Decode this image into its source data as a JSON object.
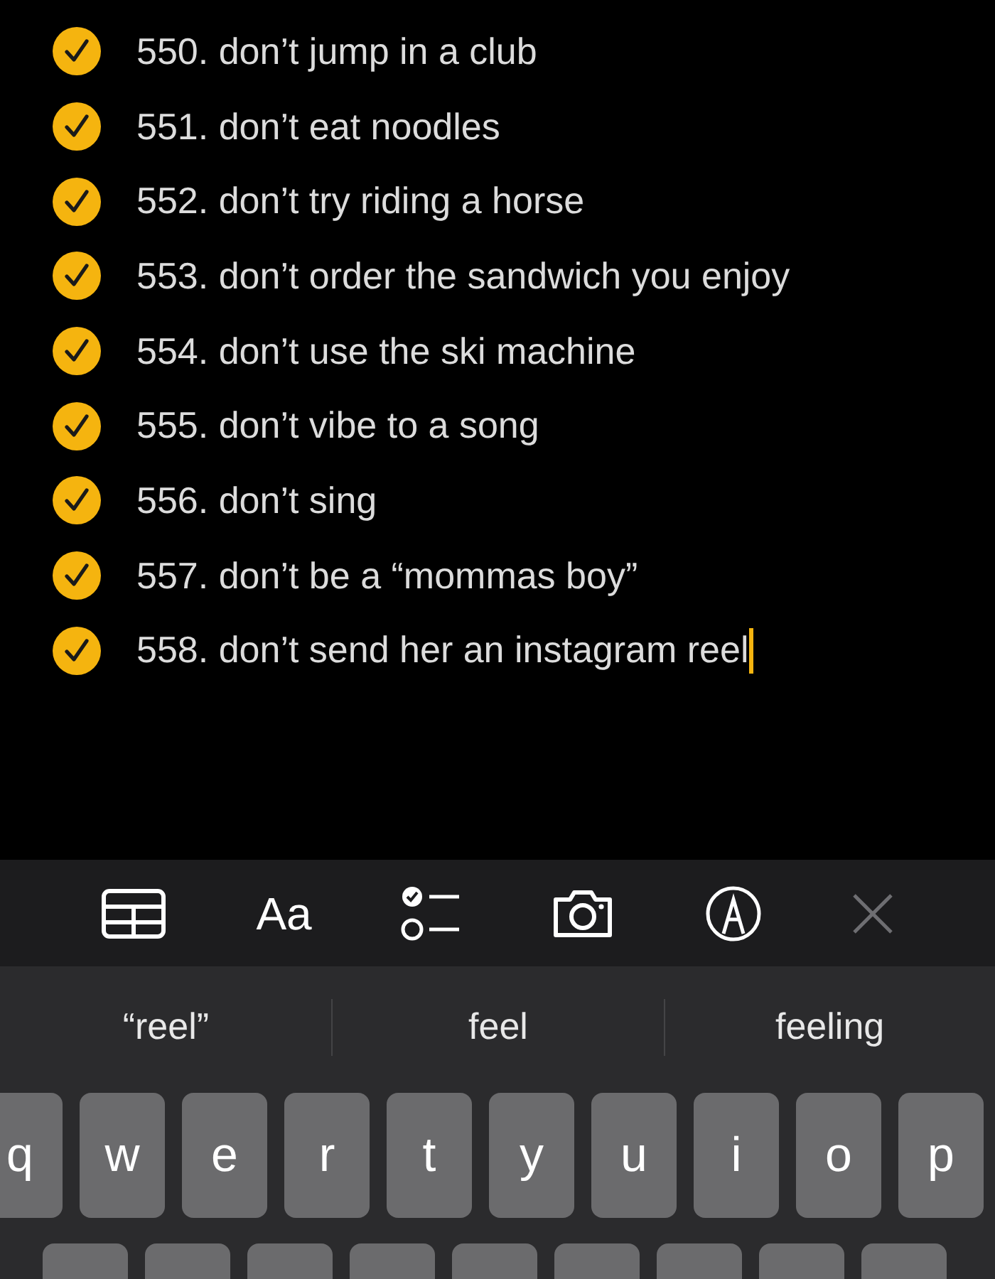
{
  "checklist": [
    {
      "text": "550. don’t jump in a club",
      "checked": true
    },
    {
      "text": "551. don’t eat noodles",
      "checked": true
    },
    {
      "text": "552. don’t try riding a horse",
      "checked": true
    },
    {
      "text": "553. don’t order the sandwich you enjoy",
      "checked": true
    },
    {
      "text": "554. don’t use the ski machine",
      "checked": true
    },
    {
      "text": "555. don’t vibe to a song",
      "checked": true
    },
    {
      "text": "556. don’t sing",
      "checked": true
    },
    {
      "text": "557. don’t be a “mommas boy”",
      "checked": true
    },
    {
      "text": "558. don’t send her an instagram reel",
      "checked": true
    }
  ],
  "text_cursor": true,
  "toolbar": {
    "format_label": "Aa"
  },
  "suggestions": [
    "“reel”",
    "feel",
    "feeling"
  ],
  "keyboard": {
    "row_1": [
      "q",
      "w",
      "e",
      "r",
      "t",
      "y",
      "u",
      "i",
      "o",
      "p"
    ],
    "row_2": [
      {
        "kind": "covered"
      },
      {
        "kind": "covered"
      },
      {
        "kind": "covered"
      },
      {
        "kind": "covered"
      },
      {
        "kind": "covered"
      },
      {
        "kind": "covered"
      },
      {
        "kind": "covered"
      },
      {
        "kind": "covered"
      },
      {
        "kind": "covered"
      }
    ]
  }
}
